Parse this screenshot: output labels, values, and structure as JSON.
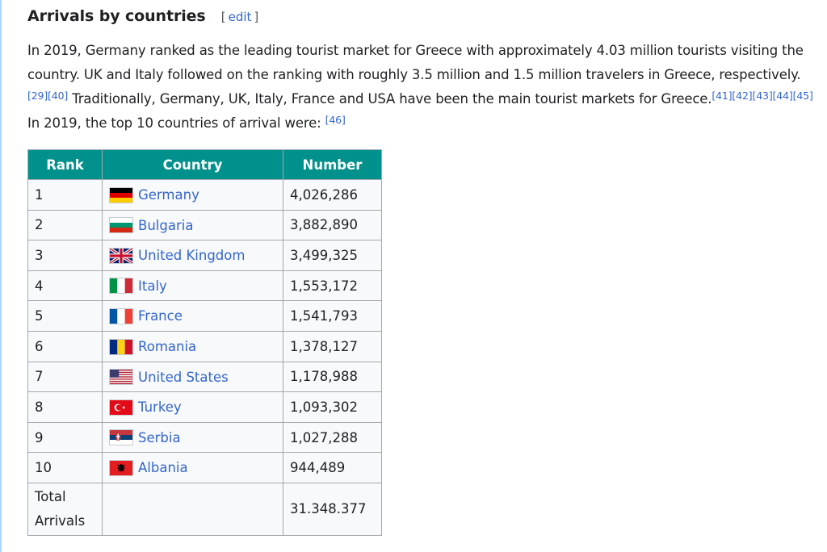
{
  "section": {
    "title": "Arrivals by countries",
    "edit_open": "[",
    "edit_label": "edit",
    "edit_close": "]"
  },
  "paragraph": {
    "part1": "In 2019, Germany ranked as the leading tourist market for Greece with approximately 4.03 million tourists visiting the country. UK and Italy followed on the ranking with roughly 3.5 million and 1.5 million travelers in Greece, respectively.",
    "ref1": "[29][40]",
    "part2": " Traditionally, Germany, UK, Italy, France and USA have been the main tourist markets for Greece.",
    "ref2": "[41][42][43][44][45]",
    "part3": " In 2019, the top 10 countries of arrival were: ",
    "ref3": "[46]"
  },
  "table": {
    "headers": {
      "rank": "Rank",
      "country": "Country",
      "number": "Number"
    },
    "rows": [
      {
        "rank": "1",
        "country": "Germany",
        "number": "4,026,286",
        "flag": "germany-flag-icon"
      },
      {
        "rank": "2",
        "country": "Bulgaria",
        "number": "3,882,890",
        "flag": "bulgaria-flag-icon"
      },
      {
        "rank": "3",
        "country": "United Kingdom",
        "number": "3,499,325",
        "flag": "uk-flag-icon"
      },
      {
        "rank": "4",
        "country": "Italy",
        "number": "1,553,172",
        "flag": "italy-flag-icon"
      },
      {
        "rank": "5",
        "country": "France",
        "number": "1,541,793",
        "flag": "france-flag-icon"
      },
      {
        "rank": "6",
        "country": "Romania",
        "number": "1,378,127",
        "flag": "romania-flag-icon"
      },
      {
        "rank": "7",
        "country": "United States",
        "number": "1,178,988",
        "flag": "usa-flag-icon"
      },
      {
        "rank": "8",
        "country": "Turkey",
        "number": "1,093,302",
        "flag": "turkey-flag-icon"
      },
      {
        "rank": "9",
        "country": "Serbia",
        "number": "1,027,288",
        "flag": "serbia-flag-icon"
      },
      {
        "rank": "10",
        "country": "Albania",
        "number": "944,489",
        "flag": "albania-flag-icon"
      }
    ],
    "total": {
      "label_line1": "Total",
      "label_line2": "Arrivals",
      "number": "31.348.377"
    }
  },
  "colors": {
    "header_bg": "#00918c",
    "link": "#3366cc",
    "text": "#202122",
    "border": "#a2a9b1",
    "cell_bg": "#f8f9fa"
  }
}
